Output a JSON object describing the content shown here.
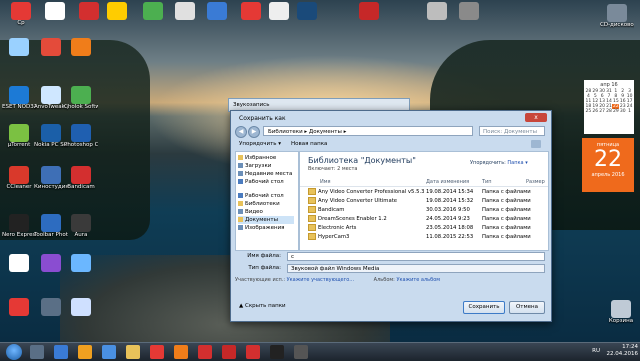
{
  "desktop": {
    "top_row": [
      "Cp",
      "",
      "",
      "",
      "",
      "",
      "",
      "",
      "",
      "",
      "",
      "",
      ""
    ],
    "left_icons": [
      {
        "label": "",
        "color": "#9ad1ff"
      },
      {
        "label": "",
        "color": "#e44b3a"
      },
      {
        "label": "",
        "color": "#f07d1a"
      },
      {
        "label": "ESET NOD32 Antivirus",
        "color": "#1c7ad6"
      },
      {
        "label": "AnvoTweak утилита",
        "color": "#cfe7ff"
      },
      {
        "label": "Cholok Softwa",
        "color": "#4caf50"
      },
      {
        "label": "µTorrent",
        "color": "#7bc142"
      },
      {
        "label": "Nokia PC Suite",
        "color": "#1b5fa8"
      },
      {
        "label": "Photoshop CS6",
        "color": "#1f5fb0"
      },
      {
        "label": "CCleaner",
        "color": "#d9392b"
      },
      {
        "label": "Киностудия Windows Live",
        "color": "#3e6fb6"
      },
      {
        "label": "Bandicam",
        "color": "#d32f2f"
      },
      {
        "label": "Nero Express",
        "color": "#222"
      },
      {
        "label": "Toolbar Photoshop",
        "color": "#2d6cc0"
      },
      {
        "label": "Aura",
        "color": "#3a3a3a"
      },
      {
        "label": "",
        "color": "#ffffff"
      },
      {
        "label": "",
        "color": "#8a4dd1"
      },
      {
        "label": "",
        "color": "#6bb7ff"
      },
      {
        "label": "",
        "color": "#e53935"
      },
      {
        "label": "",
        "color": "#5a6f86"
      },
      {
        "label": "",
        "color": "#cfe0ff"
      }
    ],
    "right_icons": [
      {
        "label": "CD-дисковод",
        "color": "#7a8a9a"
      },
      {
        "label": "Корзина",
        "color": "#bfcad6"
      }
    ]
  },
  "calendar": {
    "month": "апр 16",
    "days": [
      "28",
      "29",
      "30",
      "31",
      "1",
      "2",
      "3",
      "4",
      "5",
      "6",
      "7",
      "8",
      "9",
      "10",
      "11",
      "12",
      "13",
      "14",
      "15",
      "16",
      "17",
      "18",
      "19",
      "20",
      "21",
      "22",
      "23",
      "24",
      "25",
      "26",
      "27",
      "28",
      "29",
      "30",
      "1"
    ]
  },
  "date_tile": {
    "weekday": "пятница",
    "day": "22",
    "month_year": "апрель 2016"
  },
  "behind_window": {
    "title": "Звукозапись"
  },
  "dialog": {
    "title": "Сохранить как",
    "close": "x",
    "address": "Библиотеки ▸ Документы ▸",
    "search_placeholder": "Поиск: Документы",
    "toolbar": {
      "organize": "Упорядочить ▾",
      "new_folder": "Новая папка"
    },
    "sidebar": [
      {
        "label": "Избранное",
        "color": "#e8c25a"
      },
      {
        "label": "Загрузки",
        "color": "#6b8fb8"
      },
      {
        "label": "Недавние места",
        "color": "#6b8fb8"
      },
      {
        "label": "Рабочий стол",
        "color": "#4a7bbf"
      },
      {
        "label": "Рабочий стол",
        "color": "#4a7bbf"
      },
      {
        "label": "Библиотеки",
        "color": "#e8c25a"
      },
      {
        "label": "Видео",
        "color": "#6b8fb8"
      },
      {
        "label": "Документы",
        "color": "#e8c25a"
      },
      {
        "label": "Изображения",
        "color": "#6b8fb8"
      }
    ],
    "library": {
      "title": "Библиотека \"Документы\"",
      "subtitle": "Включает: 2 места",
      "arrange_label": "Упорядочить:",
      "arrange_value": "Папка ▾"
    },
    "columns": {
      "name": "Имя",
      "date": "Дата изменения",
      "type": "Тип",
      "size": "Размер"
    },
    "files": [
      {
        "name": "Any Video Converter Professional v5.5.3 F...",
        "date": "19.08.2014 15:34",
        "type": "Папка с файлами"
      },
      {
        "name": "Any Video Converter Ultimate",
        "date": "19.08.2014 15:32",
        "type": "Папка с файлами"
      },
      {
        "name": "Bandicam",
        "date": "30.03.2016 9:50",
        "type": "Папка с файлами"
      },
      {
        "name": "DreamScenes Enabler 1.2",
        "date": "24.05.2014 9:23",
        "type": "Папка с файлами"
      },
      {
        "name": "Electronic Arts",
        "date": "23.05.2014 18:08",
        "type": "Папка с файлами"
      },
      {
        "name": "HyperCam3",
        "date": "11.08.2015 22:53",
        "type": "Папка с файлами"
      }
    ],
    "filename_label": "Имя файла:",
    "filename_value": "с",
    "filetype_label": "Тип файла:",
    "filetype_value": "Звуковой файл Windows Media",
    "authors_label": "Участвующие исп.:",
    "authors_link": "Укажите участвующего...",
    "album_label": "Альбом:",
    "album_link": "Укажите альбом",
    "hide_folders": "▲ Скрыть папки",
    "save": "Сохранить",
    "cancel": "Отмена"
  },
  "taskbar": {
    "time": "17:24",
    "date": "22.04.2016",
    "lang": "RU"
  }
}
